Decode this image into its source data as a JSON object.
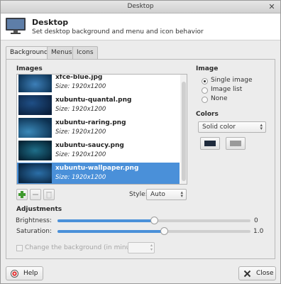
{
  "window": {
    "title": "Desktop",
    "close_glyph": "✕"
  },
  "header": {
    "title": "Desktop",
    "subtitle": "Set desktop background and menu and icon behavior",
    "icon": "monitor-icon"
  },
  "tabs": [
    {
      "label": "Background",
      "active": true
    },
    {
      "label": "Menus",
      "active": false
    },
    {
      "label": "Icons",
      "active": false
    }
  ],
  "images": {
    "section_title": "Images",
    "items": [
      {
        "name": "xfce-blue.jpg",
        "size": "Size: 1920x1200",
        "selected": false
      },
      {
        "name": "xubuntu-quantal.png",
        "size": "Size: 1920x1200",
        "selected": false
      },
      {
        "name": "xubuntu-raring.png",
        "size": "Size: 1920x1200",
        "selected": false
      },
      {
        "name": "xubuntu-saucy.png",
        "size": "Size: 1920x1200",
        "selected": false
      },
      {
        "name": "xubuntu-wallpaper.png",
        "size": "Size: 1920x1200",
        "selected": true
      }
    ],
    "style_label": "Style:",
    "style_value": "Auto"
  },
  "image_mode": {
    "section_title": "Image",
    "options": [
      {
        "label": "Single image",
        "checked": true
      },
      {
        "label": "Image list",
        "checked": false
      },
      {
        "label": "None",
        "checked": false
      }
    ]
  },
  "colors": {
    "section_title": "Colors",
    "mode_value": "Solid color",
    "primary": "#1e2a3c",
    "secondary": "#9a9a9a"
  },
  "adjustments": {
    "section_title": "Adjustments",
    "brightness": {
      "label": "Brightness:",
      "value": "0",
      "fraction": 0.5
    },
    "saturation": {
      "label": "Saturation:",
      "value": "1.0",
      "fraction": 0.55
    }
  },
  "change_bg": {
    "label": "Change the background (in minutes):",
    "checked": false
  },
  "buttons": {
    "help": "Help",
    "close": "Close"
  },
  "accent": "#4a90d9"
}
